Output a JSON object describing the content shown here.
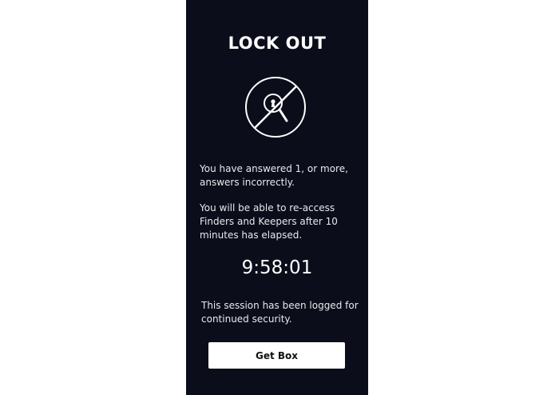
{
  "screen": {
    "title": "LOCK OUT",
    "icon": "search-blocked-icon",
    "message_1": "You have answered 1, or more, answers incorrectly.",
    "message_2": "You will be able to re-access Finders and Keepers after 10 minutes has elapsed.",
    "timer": "9:58:01",
    "message_3": "This session has been logged for continued security.",
    "button_label": "Get Box"
  },
  "colors": {
    "background": "#0b0e1a",
    "text": "#ffffff",
    "button_bg": "#ffffff",
    "button_text": "#111111"
  }
}
